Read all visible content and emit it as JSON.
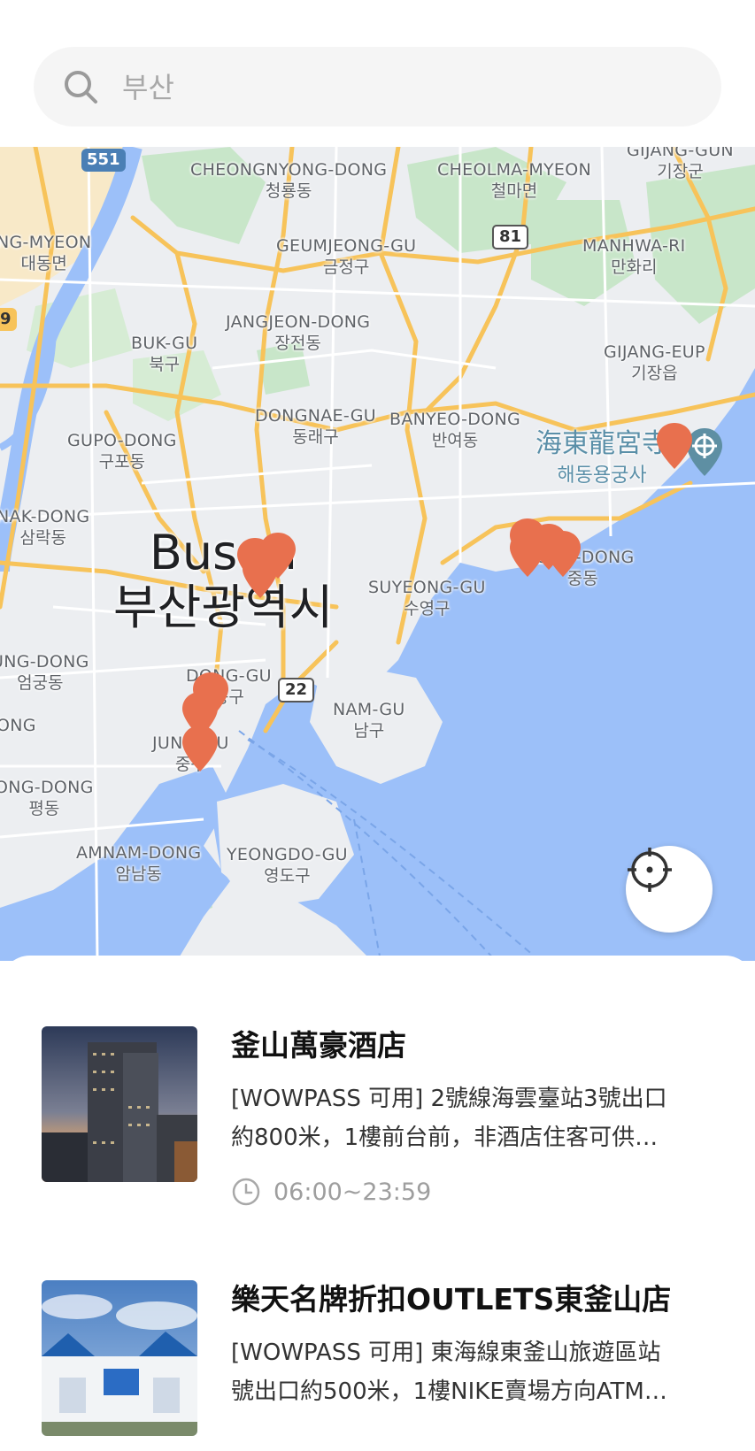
{
  "search": {
    "placeholder": "부산",
    "value": ""
  },
  "map": {
    "city": {
      "en": "Busan",
      "ko": "부산광역시"
    },
    "labels": [
      {
        "id": "cheongnyong",
        "lat": "CHEONGNYONG-DONG",
        "ko": "청룡동"
      },
      {
        "id": "cheolma",
        "lat": "CHEOLMA-MYEON",
        "ko": "철마면"
      },
      {
        "id": "gijang_gun",
        "lat": "GIJANG-GUN",
        "ko": "기장군"
      },
      {
        "id": "ng_myeon",
        "lat": "NG-MYEON",
        "ko": "대동면"
      },
      {
        "id": "geumjeong",
        "lat": "GEUMJEONG-GU",
        "ko": "금정구"
      },
      {
        "id": "manhwa",
        "lat": "MANHWA-RI",
        "ko": "만화리"
      },
      {
        "id": "jangjeon",
        "lat": "JANGJEON-DONG",
        "ko": "장전동"
      },
      {
        "id": "buk_gu",
        "lat": "BUK-GU",
        "ko": "북구"
      },
      {
        "id": "gijang_eup",
        "lat": "GIJANG-EUP",
        "ko": "기장읍"
      },
      {
        "id": "dongnae",
        "lat": "DONGNAE-GU",
        "ko": "동래구"
      },
      {
        "id": "banyeo",
        "lat": "BANYEO-DONG",
        "ko": "반여동"
      },
      {
        "id": "gupo",
        "lat": "GUPO-DONG",
        "ko": "구포동"
      },
      {
        "id": "nak_dong",
        "lat": "NAK-DONG",
        "ko": "삼락동"
      },
      {
        "id": "suyeong",
        "lat": "SUYEONG-GU",
        "ko": "수영구"
      },
      {
        "id": "jung_dong",
        "lat": "JUNG-DONG",
        "ko": "중동"
      },
      {
        "id": "ung_dong",
        "lat": "UNG-DONG",
        "ko": "엄궁동"
      },
      {
        "id": "dong_gu",
        "lat": "DONG-GU",
        "ko": "동구"
      },
      {
        "id": "nam_gu",
        "lat": "NAM-GU",
        "ko": "남구"
      },
      {
        "id": "ong",
        "lat": "ONG",
        "ko": ""
      },
      {
        "id": "jung_gu",
        "lat": "JUNG-GU",
        "ko": "중구"
      },
      {
        "id": "ong_dong",
        "lat": "ONG-DONG",
        "ko": "평동"
      },
      {
        "id": "amnam",
        "lat": "AMNAM-DONG",
        "ko": "암남동"
      },
      {
        "id": "yeongdo",
        "lat": "YEONGDO-GU",
        "ko": "영도구"
      }
    ],
    "poi": {
      "name_cn": "海東龍宮寺",
      "name_ko": "해동용궁사"
    },
    "route_shields": [
      "551",
      "81",
      "22",
      "9"
    ],
    "pin_color": "#e8704e",
    "water_color": "#9cc0f9",
    "park_color": "#c4e8c6",
    "road_color": "#f7c35a"
  },
  "locate_button": {
    "icon": "crosshair-icon"
  },
  "stores": [
    {
      "title": "釜山萬豪酒店",
      "desc_line1": "[WOWPASS 可用] 2號線海雲臺站3號出口",
      "desc_line2": "約800米，1樓前台前，非酒店住客可供…",
      "hours": "06:00~23:59"
    },
    {
      "title": "樂天名牌折扣OUTLETS東釜山店",
      "desc_line1": "[WOWPASS 可用] 東海線東釜山旅遊區站",
      "desc_line2": "號出口約500米，1樓NIKE賣場方向ATM…",
      "hours": ""
    }
  ]
}
